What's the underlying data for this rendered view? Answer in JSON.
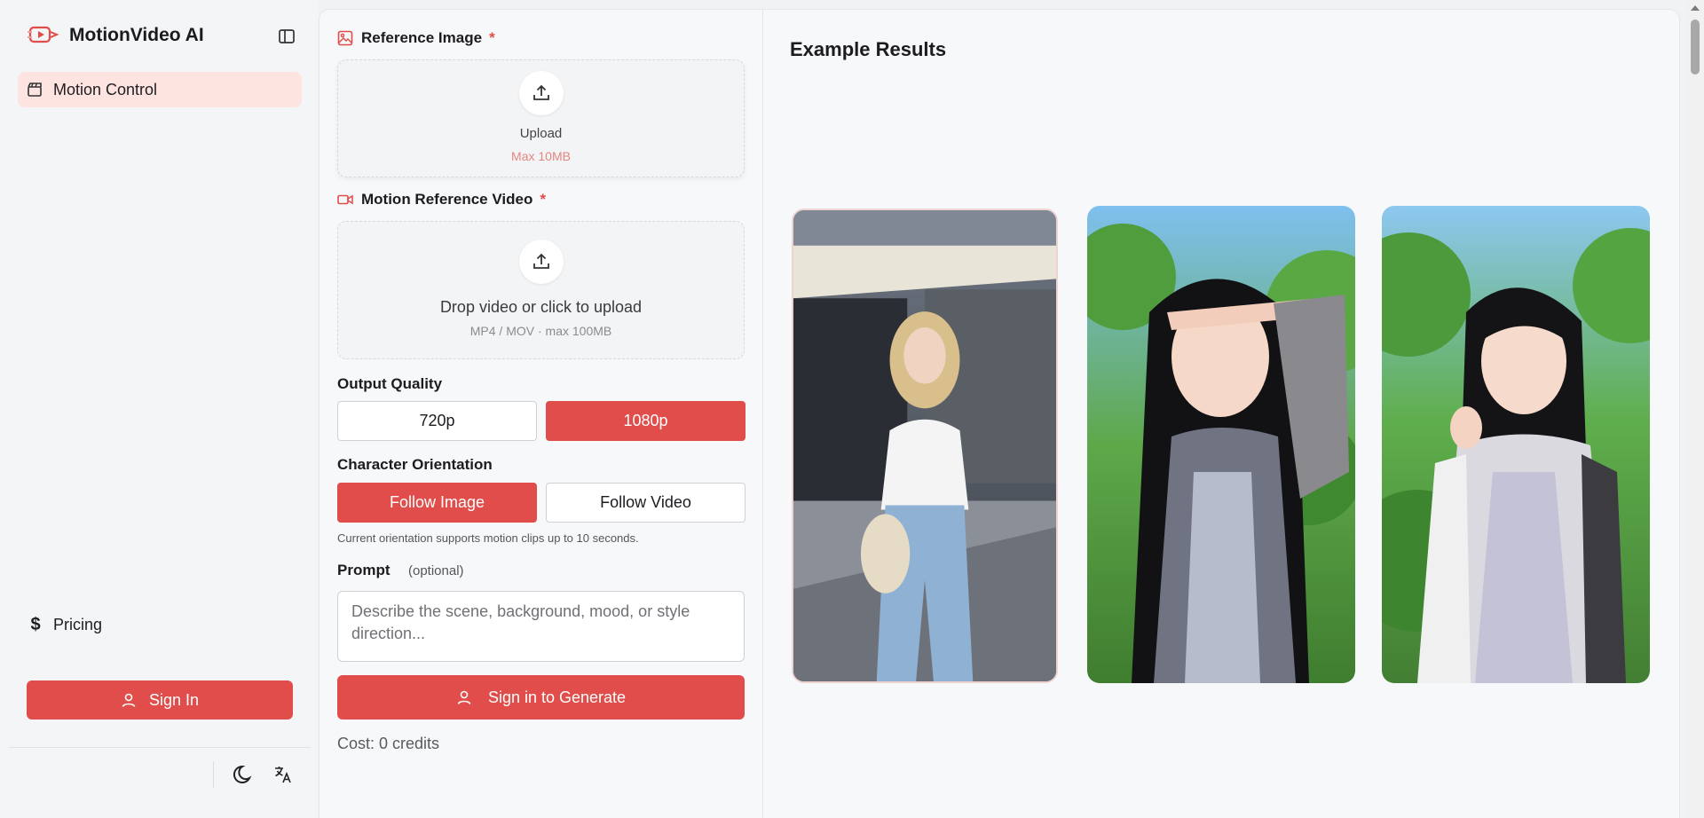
{
  "app": {
    "name": "MotionVideo AI",
    "accent": "#e04d4a"
  },
  "sidebar": {
    "items": [
      {
        "label": "Motion Control",
        "icon": "clapperboard-icon",
        "active": true
      }
    ],
    "pricing": {
      "label": "Pricing",
      "icon": "dollar-icon"
    },
    "sign_in": {
      "label": "Sign In",
      "icon": "user-icon"
    },
    "footer_icons": [
      "moon-icon",
      "translate-icon"
    ]
  },
  "form": {
    "reference_image": {
      "label": "Reference Image",
      "required_mark": "*",
      "upload_label": "Upload",
      "limit": "Max 10MB"
    },
    "motion_video": {
      "label": "Motion Reference Video",
      "required_mark": "*",
      "upload_label": "Drop video or click to upload",
      "limit": "MP4 / MOV · max 100MB"
    },
    "output_quality": {
      "label": "Output Quality",
      "options": [
        "720p",
        "1080p"
      ],
      "selected": "1080p"
    },
    "orientation": {
      "label": "Character Orientation",
      "options": [
        "Follow Image",
        "Follow Video"
      ],
      "selected": "Follow Image",
      "hint": "Current orientation supports motion clips up to 10 seconds."
    },
    "prompt": {
      "label": "Prompt",
      "optional": "(optional)",
      "placeholder": "Describe the scene, background, mood, or style direction..."
    },
    "generate_label": "Sign in to Generate",
    "cost": "Cost: 0 credits"
  },
  "results": {
    "title": "Example Results"
  }
}
